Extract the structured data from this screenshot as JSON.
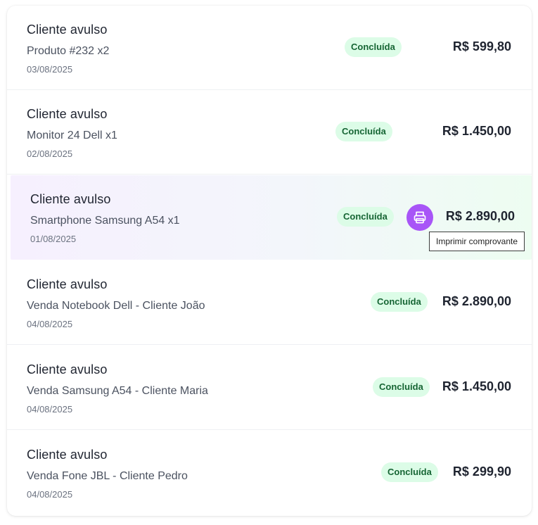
{
  "sales": [
    {
      "client": "Cliente avulso",
      "product": "Produto #232 x2",
      "date": "03/08/2025",
      "status": "Concluída",
      "amount": "R$ 599,80"
    },
    {
      "client": "Cliente avulso",
      "product": "Monitor 24 Dell x1",
      "date": "02/08/2025",
      "status": "Concluída",
      "amount": "R$ 1.450,00"
    },
    {
      "client": "Cliente avulso",
      "product": "Smartphone Samsung A54 x1",
      "date": "01/08/2025",
      "status": "Concluída",
      "amount": "R$ 2.890,00"
    },
    {
      "client": "Cliente avulso",
      "product": "Venda Notebook Dell - Cliente João",
      "date": "04/08/2025",
      "status": "Concluída",
      "amount": "R$ 2.890,00"
    },
    {
      "client": "Cliente avulso",
      "product": "Venda Samsung A54 - Cliente Maria",
      "date": "04/08/2025",
      "status": "Concluída",
      "amount": "R$ 1.450,00"
    },
    {
      "client": "Cliente avulso",
      "product": "Venda Fone JBL - Cliente Pedro",
      "date": "04/08/2025",
      "status": "Concluída",
      "amount": "R$ 299,90"
    }
  ],
  "print_action": {
    "icon": "printer-icon",
    "tooltip": "Imprimir comprovante"
  },
  "colors": {
    "badge_bg": "#dcfce7",
    "badge_text": "#166534",
    "print_button": "#a855f7"
  }
}
